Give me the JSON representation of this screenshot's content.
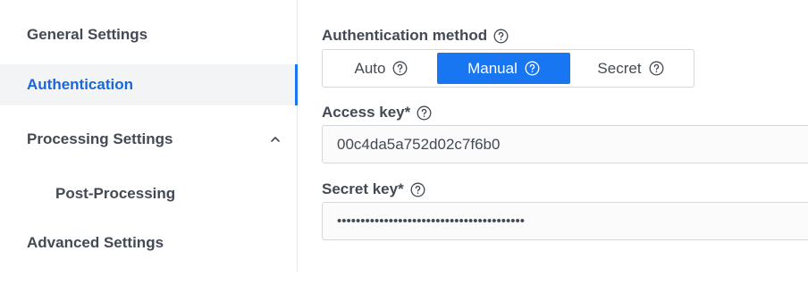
{
  "sidebar": {
    "items": [
      {
        "label": "General Settings"
      },
      {
        "label": "Authentication"
      },
      {
        "label": "Processing Settings"
      },
      {
        "label": "Post-Processing"
      },
      {
        "label": "Advanced Settings"
      }
    ]
  },
  "auth": {
    "method_label": "Authentication method",
    "methods": [
      {
        "label": "Auto"
      },
      {
        "label": "Manual",
        "selected": true
      },
      {
        "label": "Secret"
      }
    ],
    "access_key_label": "Access key*",
    "access_key_value": "00c4da5a752d02c7f6b0",
    "secret_key_label": "Secret key*",
    "secret_key_value": "••••••••••••••••••••••••••••••••••••••••"
  },
  "colors": {
    "accent": "#1876f2",
    "active_bg": "#f3f4f6",
    "text": "#434a54"
  },
  "icons": {
    "help": "help-circle-icon",
    "chevron": "chevron-up-icon"
  }
}
